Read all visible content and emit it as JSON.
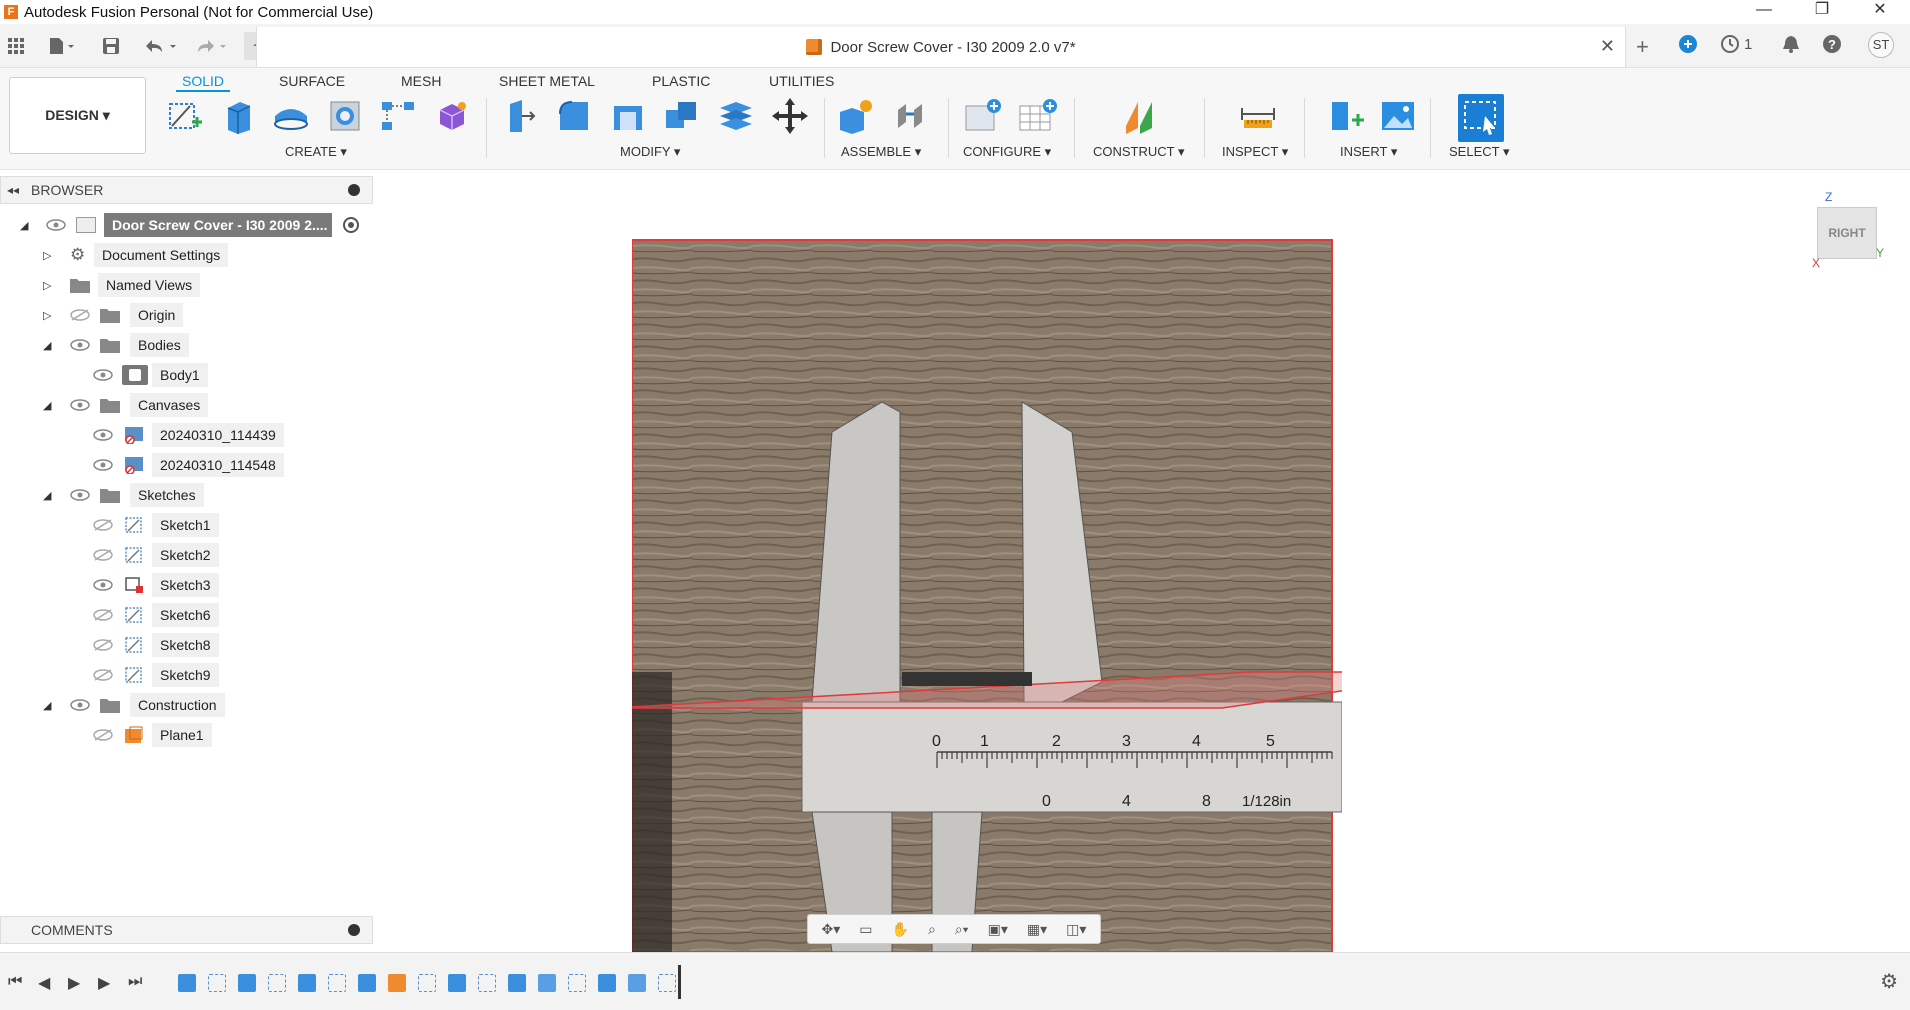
{
  "window": {
    "title": "Autodesk Fusion Personal (Not for Commercial Use)",
    "minimize": "—",
    "restore": "❐",
    "close": "✕"
  },
  "doc_tab": {
    "title": "Door Screw Cover - I30 2009 2.0 v7*",
    "close": "✕"
  },
  "header_right": {
    "jobs_count": "1",
    "user_initials": "ST"
  },
  "ribbon": {
    "workspace": "DESIGN ▾",
    "tabs": [
      "SOLID",
      "SURFACE",
      "MESH",
      "SHEET METAL",
      "PLASTIC",
      "UTILITIES"
    ],
    "active_tab": "SOLID",
    "groups": {
      "create": "CREATE ▾",
      "modify": "MODIFY ▾",
      "assemble": "ASSEMBLE ▾",
      "configure": "CONFIGURE ▾",
      "construct": "CONSTRUCT ▾",
      "inspect": "INSPECT ▾",
      "insert": "INSERT ▾",
      "select": "SELECT ▾"
    }
  },
  "browser": {
    "title": "BROWSER",
    "root": "Door Screw Cover - I30 2009 2....",
    "items": [
      {
        "label": "Document Settings"
      },
      {
        "label": "Named Views"
      },
      {
        "label": "Origin"
      },
      {
        "label": "Bodies"
      },
      {
        "label": "Body1"
      },
      {
        "label": "Canvases"
      },
      {
        "label": "20240310_114439"
      },
      {
        "label": "20240310_114548"
      },
      {
        "label": "Sketches"
      },
      {
        "label": "Sketch1"
      },
      {
        "label": "Sketch2"
      },
      {
        "label": "Sketch3"
      },
      {
        "label": "Sketch6"
      },
      {
        "label": "Sketch8"
      },
      {
        "label": "Sketch9"
      },
      {
        "label": "Construction"
      },
      {
        "label": "Plane1"
      }
    ]
  },
  "comments": {
    "title": "COMMENTS"
  },
  "viewcube": {
    "face": "RIGHT",
    "axis_z": "Z",
    "axis_y": "Y",
    "axis_x": "X"
  },
  "caliper_scale": {
    "main_ticks": [
      "0",
      "1",
      "2",
      "3",
      "4",
      "5"
    ],
    "vernier_ticks": [
      "0",
      "4",
      "8",
      "1/128in"
    ]
  },
  "colors": {
    "accent": "#0696d7",
    "fusion_orange": "#e8741e",
    "plane_red": "#e03a3a"
  }
}
